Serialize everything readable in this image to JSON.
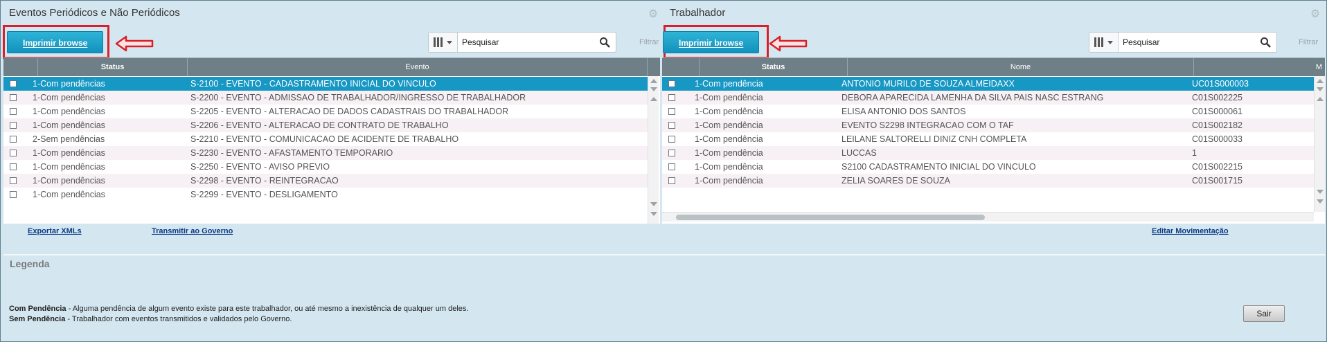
{
  "left_panel": {
    "title": "Eventos Periódicos e Não Periódicos",
    "print_button": "Imprimir browse",
    "search_placeholder": "Pesquisar",
    "filter_label": "Filtrar",
    "columns": [
      "Status",
      "Evento"
    ],
    "rows": [
      {
        "status": "1-Com pendências",
        "evento": "S-2100 - EVENTO - CADASTRAMENTO INICIAL DO VINCULO"
      },
      {
        "status": "1-Com pendências",
        "evento": "S-2200 - EVENTO - ADMISSAO DE TRABALHADOR/INGRESSO DE TRABALHADOR"
      },
      {
        "status": "1-Com pendências",
        "evento": "S-2205 - EVENTO - ALTERACAO DE DADOS CADASTRAIS DO TRABALHADOR"
      },
      {
        "status": "1-Com pendências",
        "evento": "S-2206 - EVENTO - ALTERACAO DE CONTRATO DE TRABALHO"
      },
      {
        "status": "2-Sem pendências",
        "evento": "S-2210 - EVENTO - COMUNICACAO DE ACIDENTE DE TRABALHO"
      },
      {
        "status": "1-Com pendências",
        "evento": "S-2230 - EVENTO - AFASTAMENTO TEMPORARIO"
      },
      {
        "status": "1-Com pendências",
        "evento": "S-2250 - EVENTO - AVISO PREVIO"
      },
      {
        "status": "1-Com pendências",
        "evento": "S-2298 - EVENTO - REINTEGRACAO"
      },
      {
        "status": "1-Com pendências",
        "evento": "S-2299 - EVENTO - DESLIGAMENTO"
      }
    ],
    "links": [
      "Exportar XMLs",
      "Transmitir ao Governo"
    ]
  },
  "right_panel": {
    "title": "Trabalhador",
    "print_button": "Imprimir browse",
    "search_placeholder": "Pesquisar",
    "filter_label": "Filtrar",
    "columns": [
      "Status",
      "Nome",
      "M"
    ],
    "rows": [
      {
        "status": "1-Com pendência",
        "nome": "ANTONIO MURILO DE SOUZA ALMEIDAXX",
        "matricula": "UC01S000003"
      },
      {
        "status": "1-Com pendência",
        "nome": "DEBORA APARECIDA LAMENHA DA SILVA PAIS NASC ESTRANG",
        "matricula": "C01S002225"
      },
      {
        "status": "1-Com pendência",
        "nome": "ELISA ANTONIO DOS SANTOS",
        "matricula": "C01S000061"
      },
      {
        "status": "1-Com pendência",
        "nome": "EVENTO S2298 INTEGRACAO COM O TAF",
        "matricula": "C01S002182"
      },
      {
        "status": "1-Com pendência",
        "nome": "LEILANE SALTORELLI DINIZ CNH COMPLETA",
        "matricula": "C01S000033"
      },
      {
        "status": "1-Com pendência",
        "nome": "LUCCAS",
        "matricula": "1"
      },
      {
        "status": "1-Com pendência",
        "nome": "S2100 CADASTRAMENTO INICIAL DO VINCULO",
        "matricula": "C01S002215"
      },
      {
        "status": "1-Com pendência",
        "nome": "ZELIA SOARES DE SOUZA",
        "matricula": "C01S001715"
      }
    ],
    "link": "Editar Movimentação"
  },
  "legend": {
    "title": "Legenda",
    "com_pendencia_label": "Com Pendência",
    "com_pendencia_text": " - Alguma pendência de algum evento existe para este trabalhador, ou até mesmo a inexistência de qualquer um deles.",
    "sem_pendencia_label": "Sem Pendência",
    "sem_pendencia_text": " - Trabalhador com eventos transmitidos e validados pelo Governo."
  },
  "exit_button": "Sair",
  "colors": {
    "accent": "#1797c4",
    "highlight": "#d9202a",
    "header": "#6e7f87",
    "background": "#d4e6ef"
  },
  "icons": [
    "gear-icon",
    "columns-icon",
    "search-icon",
    "red-arrow-icon"
  ]
}
